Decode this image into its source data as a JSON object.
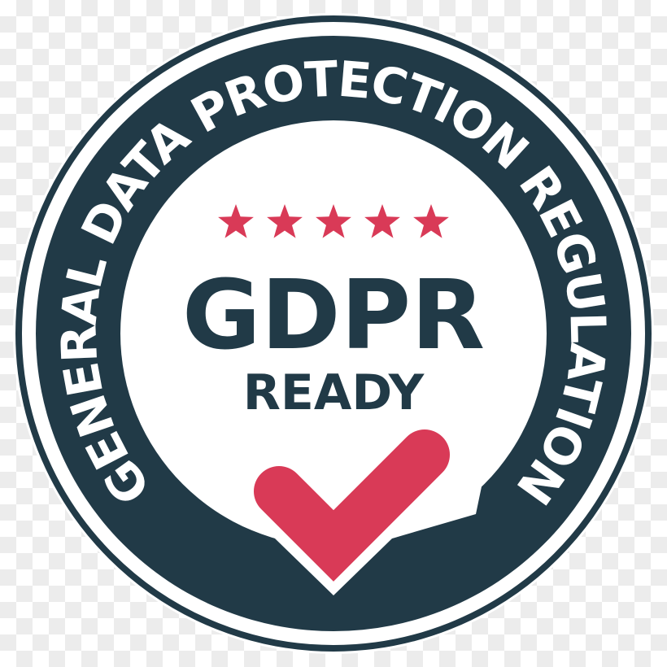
{
  "badge": {
    "ring_text": "GENERAL DATA PROTECTION REGULATION",
    "title": "GDPR",
    "subtitle": "READY",
    "star_count": 5,
    "icons": [
      "star-icon",
      "checkmark-icon"
    ],
    "colors": {
      "dark": "#213a47",
      "accent": "#d93a57",
      "white": "#ffffff"
    }
  }
}
